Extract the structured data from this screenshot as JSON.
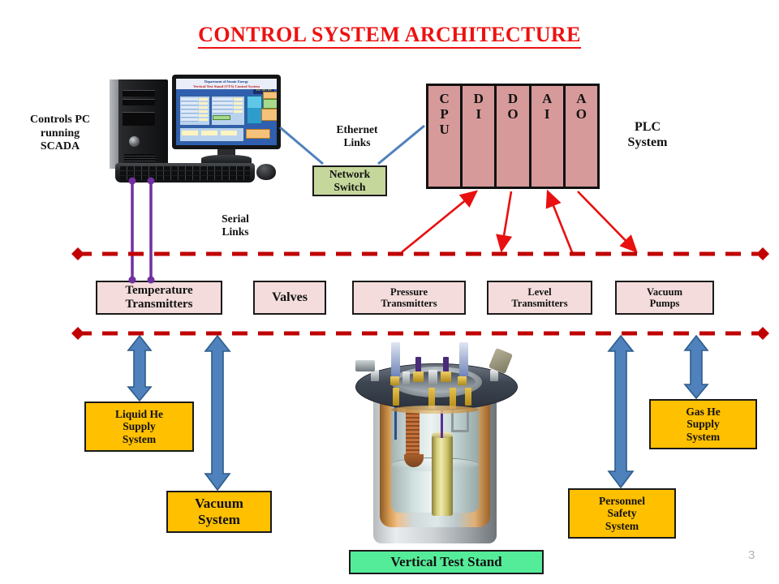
{
  "title": "CONTROL SYSTEM ARCHITECTURE",
  "page_number": "3",
  "labels": {
    "controls_pc": "Controls PC\nrunning\nSCADA",
    "controls_pc_line1": "Controls PC",
    "controls_pc_line2": "running",
    "controls_pc_line3": "SCADA",
    "ethernet_links_line1": "Ethernet",
    "ethernet_links_line2": "Links",
    "serial_links_line1": "Serial",
    "serial_links_line2": "Links",
    "plc_system_line1": "PLC",
    "plc_system_line2": "System"
  },
  "network_switch": {
    "line1": "Network",
    "line2": "Switch",
    "color": "#c6d79c"
  },
  "plc": {
    "color": "#d79a9a",
    "modules": [
      {
        "name": "cpu",
        "letters": [
          "C",
          "P",
          "U"
        ]
      },
      {
        "name": "di",
        "letters": [
          "D",
          "I"
        ]
      },
      {
        "name": "do",
        "letters": [
          "D",
          "O"
        ]
      },
      {
        "name": "ai",
        "letters": [
          "A",
          "I"
        ]
      },
      {
        "name": "ao",
        "letters": [
          "A",
          "O"
        ]
      }
    ]
  },
  "field_devices": {
    "color": "#f3dcdb",
    "items": [
      {
        "name": "temperature-transmitters",
        "line1": "Temperature",
        "line2": "Transmitters",
        "line3": ""
      },
      {
        "name": "valves",
        "line1": "Valves",
        "line2": "",
        "line3": ""
      },
      {
        "name": "pressure-transmitters",
        "line1": "Pressure",
        "line2": "Transmitters",
        "line3": ""
      },
      {
        "name": "level-transmitters",
        "line1": "Level",
        "line2": "Transmitters",
        "line3": ""
      },
      {
        "name": "vacuum-pumps",
        "line1": "Vacuum",
        "line2": "Pumps",
        "line3": ""
      }
    ]
  },
  "subsystems": {
    "color": "#ffc000",
    "items": [
      {
        "name": "liquid-he-supply-system",
        "line1": "Liquid He",
        "line2": "Supply",
        "line3": "System"
      },
      {
        "name": "vacuum-system",
        "line1": "Vacuum",
        "line2": "System",
        "line3": ""
      },
      {
        "name": "personnel-safety-system",
        "line1": "Personnel",
        "line2": "Safety",
        "line3": "System"
      },
      {
        "name": "gas-he-supply-system",
        "line1": "Gas He",
        "line2": "Supply",
        "line3": "System"
      }
    ]
  },
  "test_stand": {
    "label": "Vertical Test Stand",
    "color": "#55ec99"
  },
  "bus": {
    "color": "#c00000",
    "style": "dashed",
    "endpoint": "diamond",
    "count": 2
  },
  "colors": {
    "title_red": "#ee1111",
    "arrow_red": "#e81010",
    "serial_purple": "#7030a0",
    "ethernet_blue": "#4f81bd",
    "block_arrow_blue": "#4f81bd",
    "block_arrow_border": "#2e5c8a"
  },
  "scada_screen": {
    "header_title": "Department of Atomic Energy",
    "header_sub": "Vertical Test Stand (VTS) Control System",
    "clock": "13:44:04"
  }
}
